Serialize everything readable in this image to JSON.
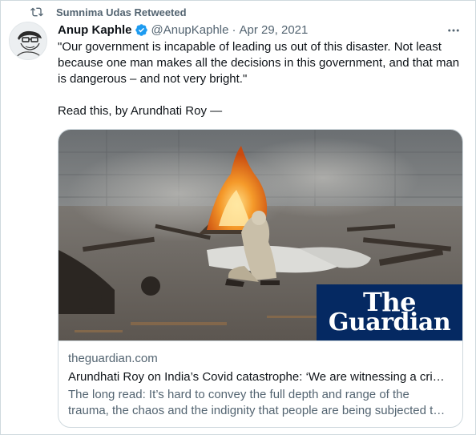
{
  "retweet": {
    "label": "Sumnima Udas Retweeted"
  },
  "tweet": {
    "author_name": "Anup Kaphle",
    "handle": "@AnupKaphle",
    "separator": "·",
    "date": "Apr 29, 2021",
    "text_paragraph_1": "\"Our government is incapable of leading us out of this disaster. Not least because one man makes all the decisions in this government, and that man is dangerous – and not very bright.\"",
    "text_paragraph_2": "Read this, by Arundhati Roy —"
  },
  "card": {
    "logo_line_1": "The",
    "logo_line_2": "Guardian",
    "domain": "theguardian.com",
    "title": "Arundhati Roy on India’s Covid catastrophe: ‘We are witnessing a cri…",
    "description": "The long read: It’s hard to convey the full depth and range of the trauma, the chaos and the indignity that people are being subjected t…"
  },
  "icons": {
    "retweet": "retweet-icon",
    "verified": "verified-badge-icon",
    "more": "more-options-icon"
  },
  "colors": {
    "text": "#0f1419",
    "secondary": "#536471",
    "verified_blue": "#1d9bf0",
    "guardian_navy": "#052962",
    "border": "#cfd9de"
  }
}
